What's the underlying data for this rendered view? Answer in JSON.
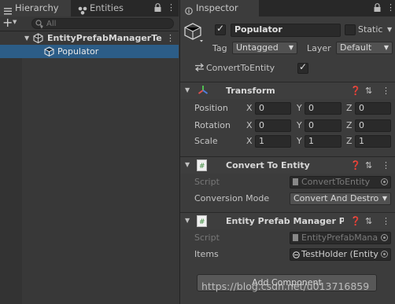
{
  "hierarchy": {
    "tabs": [
      {
        "label": "Hierarchy",
        "icon": "list-icon"
      },
      {
        "label": "Entities",
        "icon": "nodes-icon"
      }
    ],
    "add_label": "+",
    "search_placeholder": "All",
    "tree": [
      {
        "label": "EntityPrefabManagerTe",
        "bold": true,
        "icon": "unity-scene-icon",
        "expanded": true
      },
      {
        "label": "Populator",
        "selected": true,
        "icon": "cube-icon"
      }
    ]
  },
  "inspector": {
    "tab_label": "Inspector",
    "object": {
      "active": true,
      "name": "Populator",
      "static_label": "Static",
      "tag_label": "Tag",
      "tag_value": "Untagged",
      "layer_label": "Layer",
      "layer_value": "Default",
      "convert_label": "ConvertToEntity",
      "convert_checked": true
    },
    "transform": {
      "title": "Transform",
      "rows": [
        {
          "label": "Position",
          "x": "0",
          "y": "0",
          "z": "0"
        },
        {
          "label": "Rotation",
          "x": "0",
          "y": "0",
          "z": "0"
        },
        {
          "label": "Scale",
          "x": "1",
          "y": "1",
          "z": "1"
        }
      ],
      "axes": [
        "X",
        "Y",
        "Z"
      ]
    },
    "convert_to_entity": {
      "title": "Convert To Entity",
      "script_label": "Script",
      "script_value": "ConvertToEntity",
      "mode_label": "Conversion Mode",
      "mode_value": "Convert And Destro"
    },
    "entity_prefab_manager": {
      "title": "Entity Prefab Manager Pr",
      "script_label": "Script",
      "script_value": "EntityPrefabMana",
      "items_label": "Items",
      "items_value": "TestHolder (Entity"
    },
    "add_component_label": "Add Component"
  },
  "watermark": "https://blog.csdn.net/u013716859",
  "colors": {
    "selection": "#2c5d87",
    "panel_bg": "#383838",
    "field_bg": "#2a2a2a",
    "transform_icon_colors": [
      "#e05050",
      "#50c050",
      "#5080e0"
    ]
  }
}
